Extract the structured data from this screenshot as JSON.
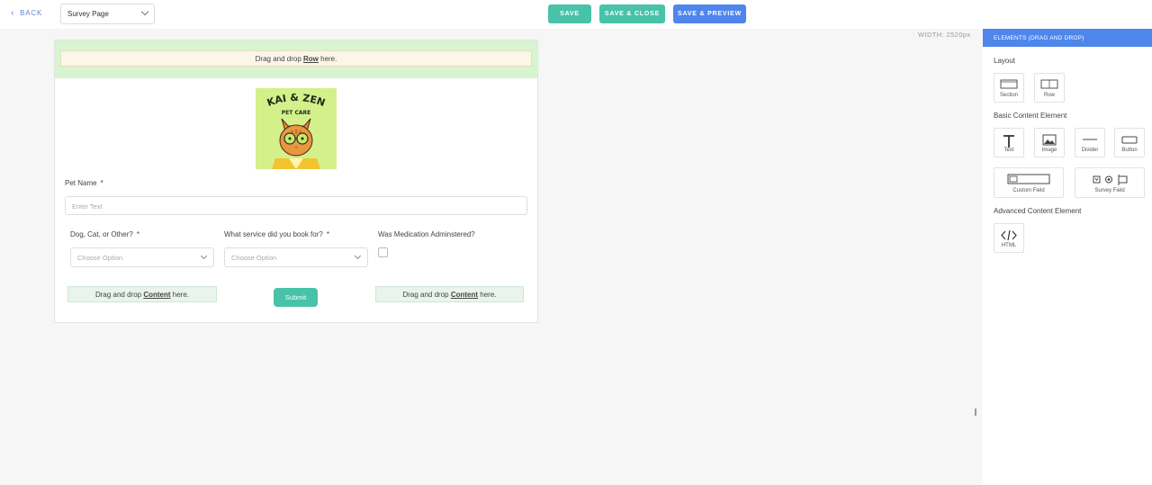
{
  "toolbar": {
    "back_label": "BACK",
    "page_select_value": "Survey Page",
    "save_label": "SAVE",
    "save_close_label": "SAVE & CLOSE",
    "save_preview_label": "SAVE & PREVIEW"
  },
  "canvas": {
    "width_label": "WIDTH: 2520px"
  },
  "survey": {
    "row_drop_prefix": "Drag and drop ",
    "row_drop_bold": "Row",
    "row_drop_suffix": " here.",
    "logo_title": "KAI & ZEN",
    "logo_subtitle": "PET CARE",
    "pet_name_label": "Pet Name",
    "required_mark": "*",
    "pet_name_placeholder": "Enter Text",
    "q1_label": "Dog, Cat, or Other?",
    "q1_placeholder": "Choose Option",
    "q2_label": "What service did you book for?",
    "q2_placeholder": "Choose Option",
    "q3_label": "Was Medication Adminstered?",
    "content_drop_prefix": "Drag and drop ",
    "content_drop_bold": "Content",
    "content_drop_suffix": " here.",
    "submit_label": "Submit"
  },
  "panel": {
    "header": "ELEMENTS (DRAG AND DROP)",
    "layout_title": "Layout",
    "layout_items": [
      "Section",
      "Row"
    ],
    "basic_title": "Basic Content Element",
    "basic_items": [
      "Text",
      "Image",
      "Divider",
      "Button",
      "Custom Field",
      "Survey Field"
    ],
    "advanced_title": "Advanced Content Element",
    "advanced_items": [
      "HTML"
    ]
  },
  "colors": {
    "accent_green": "#48c2a9",
    "accent_blue": "#4f86ec",
    "row_zone": "#d6f5d0",
    "logo_bg": "#d3f08a"
  }
}
